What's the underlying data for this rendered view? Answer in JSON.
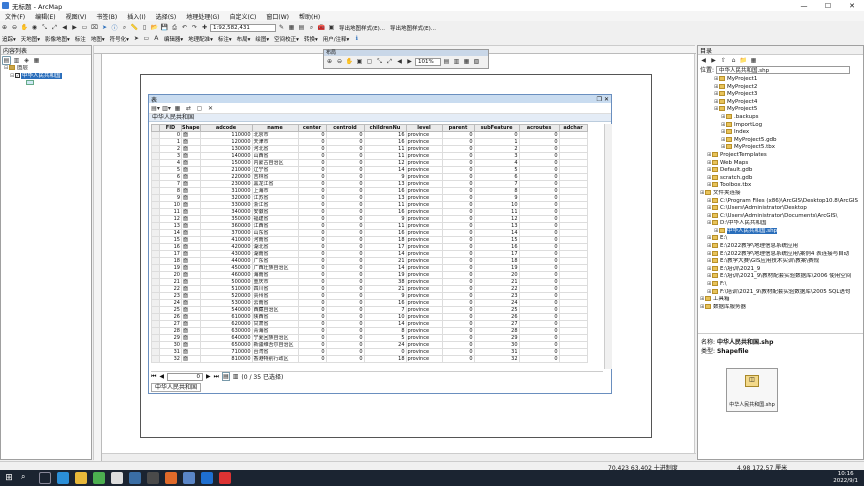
{
  "app": {
    "title": "无标题 - ArcMap",
    "win_buttons": [
      "—",
      "☐",
      "✕"
    ]
  },
  "menu": [
    "文件(F)",
    "编辑(E)",
    "视图(V)",
    "书签(B)",
    "插入(I)",
    "选择(S)",
    "地理处理(G)",
    "自定义(C)",
    "窗口(W)",
    "帮助(H)"
  ],
  "toolbar": {
    "scale": "1:92,582,431",
    "export_label_1": "导出地图样式(E)...",
    "export_label_2": "导出地图样式(E)...",
    "row2_labels": [
      "编辑器▾",
      "地理配准▾",
      "标注▾",
      "布局▾",
      "绘图▾",
      "空间校正▾",
      "转换▾",
      "用户/注释▾"
    ],
    "row2b_labels": [
      "追踪▾",
      "天地图▾",
      "影像地图▾",
      "标注",
      "地图▾",
      "符号化▾"
    ],
    "layout_zoom": "101%"
  },
  "toc": {
    "title": "内容列表",
    "layers_label": "图层",
    "layer_name": "中华人民共和国"
  },
  "float_toolbar": {
    "title": "布局",
    "zoom": "101%"
  },
  "table_window": {
    "title": "表",
    "layer_title": "中华人民共和国",
    "columns": [
      "FID",
      "Shape",
      "adcode",
      "name",
      "center",
      "centroid",
      "childrenNu",
      "level",
      "parent",
      "subFeature",
      "acroutes",
      "adchar"
    ],
    "rows": [
      [
        "0",
        "面",
        "110000",
        "北京市",
        "0",
        "0",
        "16",
        "province",
        "0",
        "0",
        "0",
        ""
      ],
      [
        "1",
        "面",
        "120000",
        "天津市",
        "0",
        "0",
        "16",
        "province",
        "0",
        "1",
        "0",
        ""
      ],
      [
        "2",
        "面",
        "130000",
        "河北省",
        "0",
        "0",
        "11",
        "province",
        "0",
        "2",
        "0",
        ""
      ],
      [
        "3",
        "面",
        "140000",
        "山西省",
        "0",
        "0",
        "11",
        "province",
        "0",
        "3",
        "0",
        ""
      ],
      [
        "4",
        "面",
        "150000",
        "内蒙古自治区",
        "0",
        "0",
        "12",
        "province",
        "0",
        "4",
        "0",
        ""
      ],
      [
        "5",
        "面",
        "210000",
        "辽宁省",
        "0",
        "0",
        "14",
        "province",
        "0",
        "5",
        "0",
        ""
      ],
      [
        "6",
        "面",
        "220000",
        "吉林省",
        "0",
        "0",
        "9",
        "province",
        "0",
        "6",
        "0",
        ""
      ],
      [
        "7",
        "面",
        "230000",
        "黑龙江省",
        "0",
        "0",
        "13",
        "province",
        "0",
        "7",
        "0",
        ""
      ],
      [
        "8",
        "面",
        "310000",
        "上海市",
        "0",
        "0",
        "16",
        "province",
        "0",
        "8",
        "0",
        ""
      ],
      [
        "9",
        "面",
        "320000",
        "江苏省",
        "0",
        "0",
        "13",
        "province",
        "0",
        "9",
        "0",
        ""
      ],
      [
        "10",
        "面",
        "330000",
        "浙江省",
        "0",
        "0",
        "11",
        "province",
        "0",
        "10",
        "0",
        ""
      ],
      [
        "11",
        "面",
        "340000",
        "安徽省",
        "0",
        "0",
        "16",
        "province",
        "0",
        "11",
        "0",
        ""
      ],
      [
        "12",
        "面",
        "350000",
        "福建省",
        "0",
        "0",
        "9",
        "province",
        "0",
        "12",
        "0",
        ""
      ],
      [
        "13",
        "面",
        "360000",
        "江西省",
        "0",
        "0",
        "11",
        "province",
        "0",
        "13",
        "0",
        ""
      ],
      [
        "14",
        "面",
        "370000",
        "山东省",
        "0",
        "0",
        "16",
        "province",
        "0",
        "14",
        "0",
        ""
      ],
      [
        "15",
        "面",
        "410000",
        "河南省",
        "0",
        "0",
        "18",
        "province",
        "0",
        "15",
        "0",
        ""
      ],
      [
        "16",
        "面",
        "420000",
        "湖北省",
        "0",
        "0",
        "17",
        "province",
        "0",
        "16",
        "0",
        ""
      ],
      [
        "17",
        "面",
        "430000",
        "湖南省",
        "0",
        "0",
        "14",
        "province",
        "0",
        "17",
        "0",
        ""
      ],
      [
        "18",
        "面",
        "440000",
        "广东省",
        "0",
        "0",
        "21",
        "province",
        "0",
        "18",
        "0",
        ""
      ],
      [
        "19",
        "面",
        "450000",
        "广西壮族自治区",
        "0",
        "0",
        "14",
        "province",
        "0",
        "19",
        "0",
        ""
      ],
      [
        "20",
        "面",
        "460000",
        "海南省",
        "0",
        "0",
        "19",
        "province",
        "0",
        "20",
        "0",
        ""
      ],
      [
        "21",
        "面",
        "500000",
        "重庆市",
        "0",
        "0",
        "38",
        "province",
        "0",
        "21",
        "0",
        ""
      ],
      [
        "22",
        "面",
        "510000",
        "四川省",
        "0",
        "0",
        "21",
        "province",
        "0",
        "22",
        "0",
        ""
      ],
      [
        "23",
        "面",
        "520000",
        "贵州省",
        "0",
        "0",
        "9",
        "province",
        "0",
        "23",
        "0",
        ""
      ],
      [
        "24",
        "面",
        "530000",
        "云南省",
        "0",
        "0",
        "16",
        "province",
        "0",
        "24",
        "0",
        ""
      ],
      [
        "25",
        "面",
        "540000",
        "西藏自治区",
        "0",
        "0",
        "7",
        "province",
        "0",
        "25",
        "0",
        ""
      ],
      [
        "26",
        "面",
        "610000",
        "陕西省",
        "0",
        "0",
        "10",
        "province",
        "0",
        "26",
        "0",
        ""
      ],
      [
        "27",
        "面",
        "620000",
        "甘肃省",
        "0",
        "0",
        "14",
        "province",
        "0",
        "27",
        "0",
        ""
      ],
      [
        "28",
        "面",
        "630000",
        "青海省",
        "0",
        "0",
        "8",
        "province",
        "0",
        "28",
        "0",
        ""
      ],
      [
        "29",
        "面",
        "640000",
        "宁夏回族自治区",
        "0",
        "0",
        "5",
        "province",
        "0",
        "29",
        "0",
        ""
      ],
      [
        "30",
        "面",
        "650000",
        "新疆维吾尔自治区",
        "0",
        "0",
        "24",
        "province",
        "0",
        "30",
        "0",
        ""
      ],
      [
        "31",
        "面",
        "710000",
        "台湾省",
        "0",
        "0",
        "0",
        "province",
        "0",
        "31",
        "0",
        ""
      ],
      [
        "32",
        "面",
        "810000",
        "香港特别行政区",
        "0",
        "0",
        "18",
        "province",
        "0",
        "32",
        "0",
        ""
      ]
    ],
    "nav_record": "0",
    "selection_status": "(0 / 35 已选择)",
    "tab": "中华人民共和国"
  },
  "catalog": {
    "title": "目录",
    "location_label": "位置:",
    "location_value": "中华人民共和国.shp",
    "items": [
      {
        "t": "MyProject1",
        "lvl": 2
      },
      {
        "t": "MyProject2",
        "lvl": 2
      },
      {
        "t": "MyProject3",
        "lvl": 2
      },
      {
        "t": "MyProject4",
        "lvl": 2
      },
      {
        "t": "MyProject5",
        "lvl": 2
      },
      {
        "t": ".backups",
        "lvl": 3
      },
      {
        "t": "ImportLog",
        "lvl": 3
      },
      {
        "t": "Index",
        "lvl": 3
      },
      {
        "t": "MyProject5.gdb",
        "lvl": 3
      },
      {
        "t": "MyProject5.tbx",
        "lvl": 3
      },
      {
        "t": "ProjectTemplates",
        "lvl": 1
      },
      {
        "t": "Web Maps",
        "lvl": 1
      },
      {
        "t": "Default.gdb",
        "lvl": 1
      },
      {
        "t": "scratch.gdb",
        "lvl": 1
      },
      {
        "t": "Toolbox.tbx",
        "lvl": 1
      },
      {
        "t": "文件夹连接",
        "lvl": 0
      },
      {
        "t": "C:\\Program Files (x86)\\ArcGIS\\Desktop10.8\\ArcGIS",
        "lvl": 1
      },
      {
        "t": "C:\\Users\\Administrator\\Desktop",
        "lvl": 1
      },
      {
        "t": "C:\\Users\\Administrator\\Documents\\ArcGIS\\",
        "lvl": 1
      },
      {
        "t": "D:\\中华人民共和国",
        "lvl": 1
      },
      {
        "t": "中华人民共和国.shp",
        "lvl": 2
      },
      {
        "t": "E:\\",
        "lvl": 1
      },
      {
        "t": "E:\\2022教学\\地理信息系统应用",
        "lvl": 1
      },
      {
        "t": "E:\\2022教学\\地理信息系统应用\\案例4 表连接与自动",
        "lvl": 1
      },
      {
        "t": "E:\\教学大赛\\GIS应用技术实训\\教案\\赛规",
        "lvl": 1
      },
      {
        "t": "E:\\培训\\2021_9",
        "lvl": 1
      },
      {
        "t": "E:\\培训\\2021_9\\教材配套实验数据库\\2006 使用空间",
        "lvl": 1
      },
      {
        "t": "F:\\",
        "lvl": 1
      },
      {
        "t": "F:\\培训\\2021_9\\教材配套实验数据库\\2005 SQL语句",
        "lvl": 1
      },
      {
        "t": "工具箱",
        "lvl": 0
      },
      {
        "t": "数据库服务器",
        "lvl": 0
      }
    ],
    "info_name_label": "名称:",
    "info_name": "中华人民共和国.shp",
    "info_type_label": "类型:",
    "info_type": "Shapefile",
    "thumb_label": "中华人民共和国.shp"
  },
  "status": {
    "coords": "70.423  63.402 十进制度",
    "page_coords": "4.98  172.57 厘米"
  },
  "taskbar": {
    "time": "10:16",
    "date": "2022/9/1"
  },
  "colors": {
    "accent": "#2a6ebb",
    "table_header": "#eaeaea",
    "titlebar_table": "#c9dcf0",
    "taskbar": "#1b2431"
  }
}
